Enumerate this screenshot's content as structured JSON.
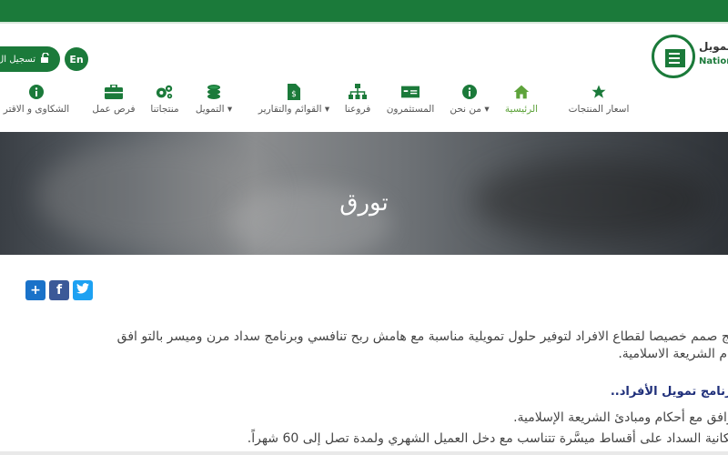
{
  "header": {
    "login_label": "تسجيل ال",
    "lang_label": "En",
    "logo_ar": "تمويل",
    "logo_en": "Natior"
  },
  "nav": {
    "items": [
      {
        "label": "اسعار المنتجات",
        "icon": "star-icon"
      },
      {
        "label": "الرئيسية",
        "icon": "home-icon",
        "active": true
      },
      {
        "label": "من نحن",
        "icon": "info-icon",
        "dropdown": true
      },
      {
        "label": "المستثمرون",
        "icon": "money-icon"
      },
      {
        "label": "فروعنا",
        "icon": "sitemap-icon"
      },
      {
        "label": "القوائم والتقارير",
        "icon": "file-dollar-icon",
        "dropdown": true
      },
      {
        "label": "التمويل",
        "icon": "coins-icon",
        "dropdown": true
      },
      {
        "label": "منتجاتنا",
        "icon": "gears-icon"
      },
      {
        "label": "فرص عمل",
        "icon": "briefcase-icon"
      },
      {
        "label": "الشكاوى و الاقتر",
        "icon": "info-icon"
      }
    ],
    "accent": "#1b7a3a",
    "active_color": "#5ea33b"
  },
  "hero": {
    "title": "تورق"
  },
  "share": {
    "add_label": "+",
    "facebook_label": "f",
    "twitter_label": "t"
  },
  "content": {
    "intro_line1": "نتج صمم خصيصا لقطاع الافراد لتوفير حلول تمويلية مناسبة مع هامش ربح تنافسي وبرنامج سداد مرن وميسر بالتو افق",
    "intro_line2": "كام الشريعة الاسلامية.",
    "heading": "برنامج تمويل الأفراد..",
    "bullet1": "توافق مع أحكام ومبادئ الشريعة الإسلامية.",
    "bullet2": "مكانية السداد على أقساط ميسَّرة تتناسب مع دخل العميل الشهري ولمدة تصل إلى 60 شهراً."
  }
}
